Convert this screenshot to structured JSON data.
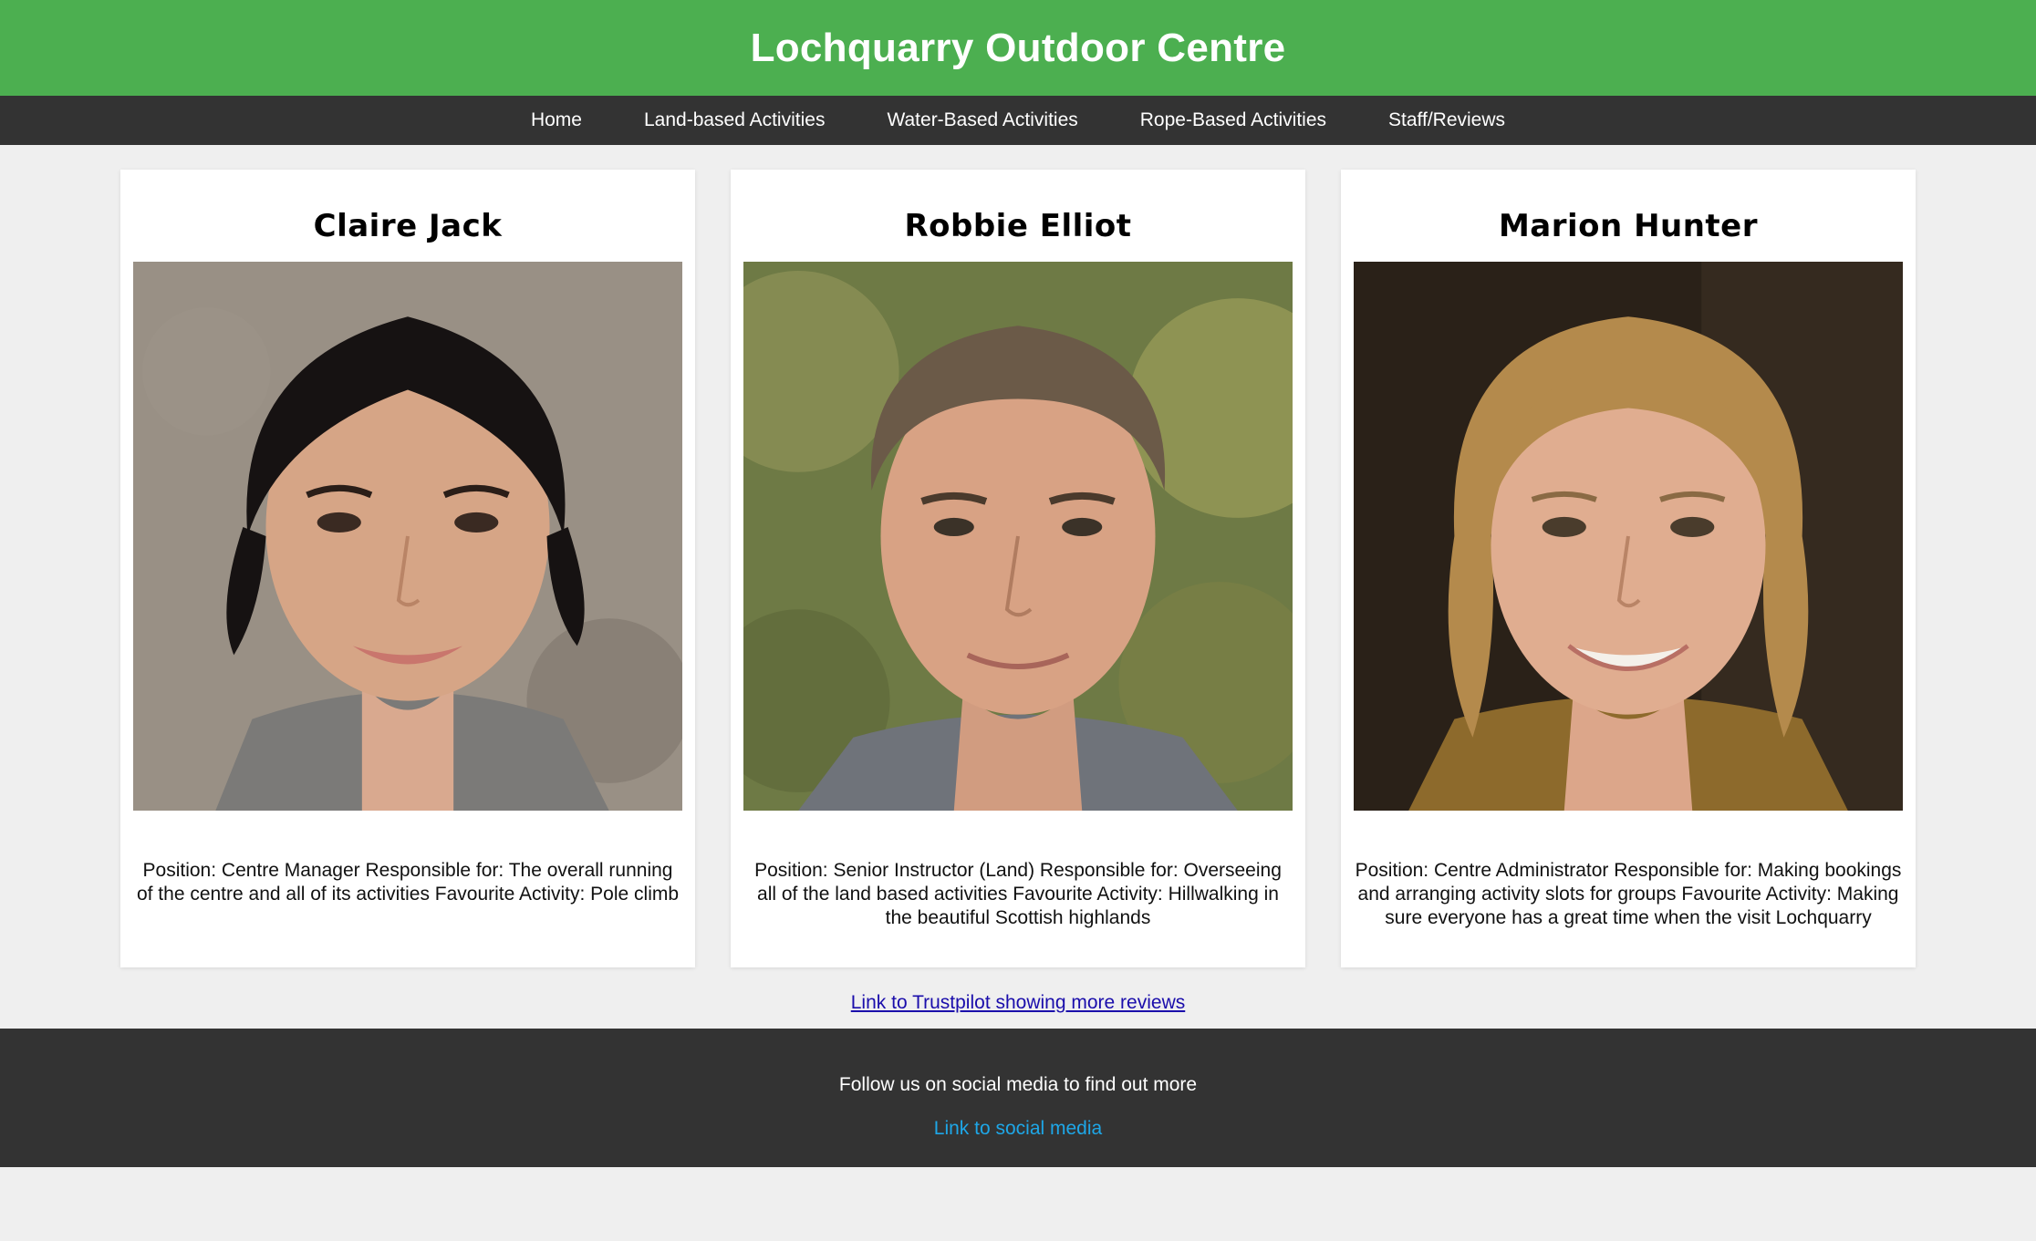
{
  "site": {
    "title": "Lochquarry Outdoor Centre"
  },
  "nav": {
    "items": [
      {
        "label": "Home"
      },
      {
        "label": "Land-based Activities"
      },
      {
        "label": "Water-Based Activities"
      },
      {
        "label": "Rope-Based Activities"
      },
      {
        "label": "Staff/Reviews"
      }
    ]
  },
  "staff": [
    {
      "name": "Claire Jack",
      "photo": "portrait-photo-woman-dark-hair",
      "description": "Position: Centre Manager Responsible for: The overall running of the centre and all of its activities Favourite Activity: Pole climb"
    },
    {
      "name": "Robbie Elliot",
      "photo": "portrait-photo-man-short-hair",
      "description": "Position: Senior Instructor (Land) Responsible for: Overseeing all of the land based activities Favourite Activity: Hillwalking in the beautiful Scottish highlands"
    },
    {
      "name": "Marion Hunter",
      "photo": "portrait-photo-woman-blonde-hair",
      "description": "Position: Centre Administrator Responsible for: Making bookings and arranging activity slots for groups Favourite Activity: Making sure everyone has a great time when the visit Lochquarry"
    }
  ],
  "reviews_link": "Link to Trustpilot showing more reviews",
  "footer": {
    "text": "Follow us on social media to find out more",
    "social_link": "Link to social media"
  },
  "colors": {
    "header_bg": "#4caf50",
    "nav_bg": "#333333",
    "footer_bg": "#333333",
    "page_bg": "#efefef",
    "link": "#1a0dab",
    "social_link": "#1ea7e8"
  }
}
